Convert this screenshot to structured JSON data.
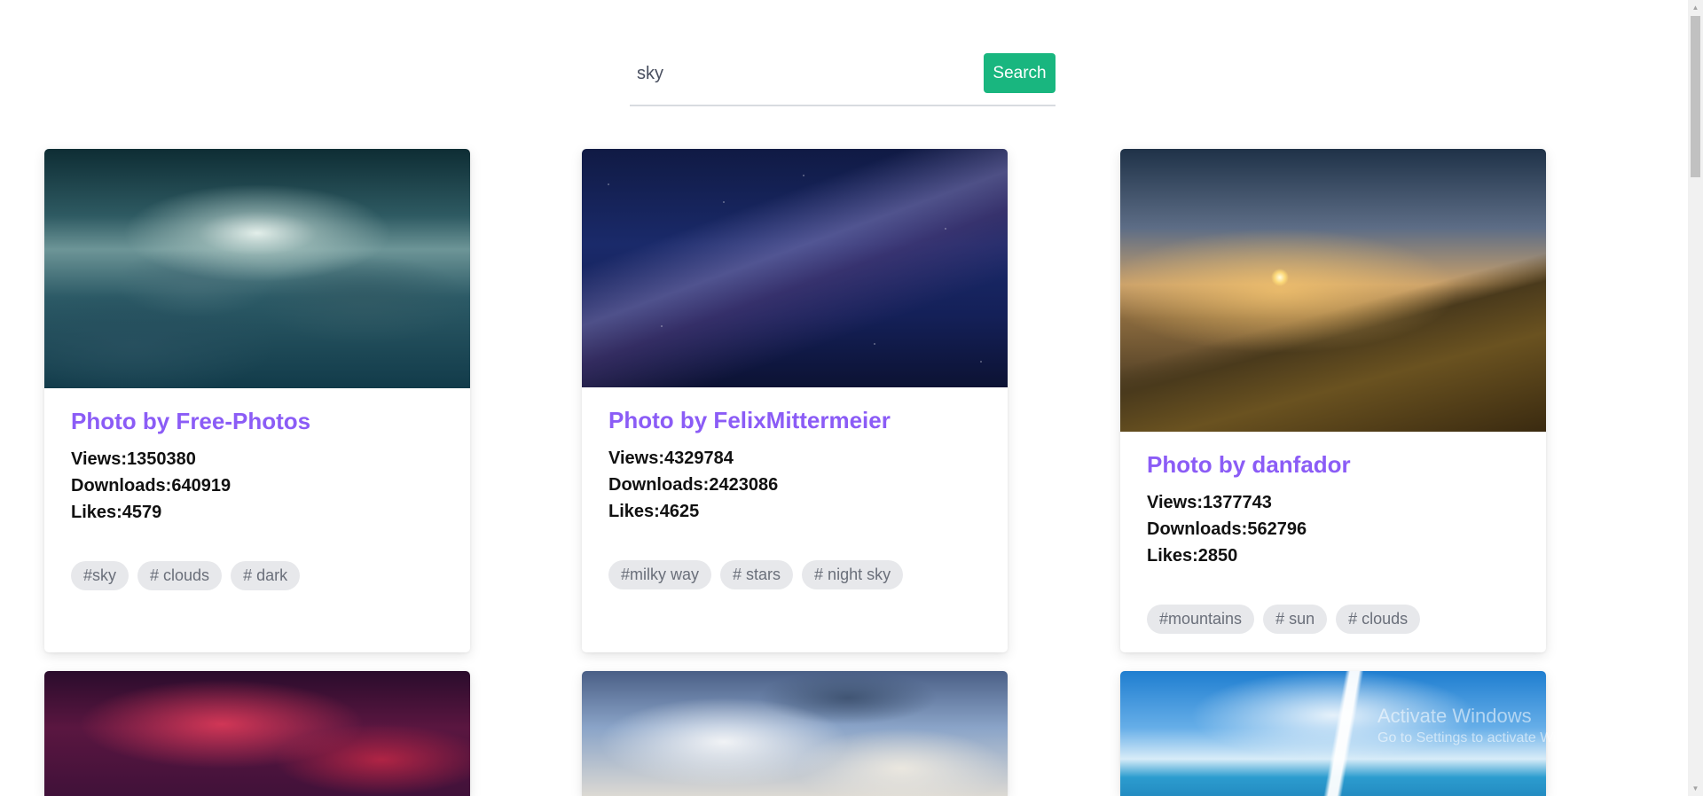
{
  "search": {
    "value": "sky",
    "button_label": "Search"
  },
  "colors": {
    "accent_button": "#19b67f",
    "title_purple": "#8b5cf6",
    "tag_background": "#e7e8eb"
  },
  "cards": [
    {
      "title": "Photo by Free-Photos",
      "views": "Views:1350380",
      "downloads": "Downloads:640919",
      "likes": "Likes:4579",
      "tags": [
        "#sky",
        "# clouds",
        "# dark"
      ]
    },
    {
      "title": "Photo by FelixMittermeier",
      "views": "Views:4329784",
      "downloads": "Downloads:2423086",
      "likes": "Likes:4625",
      "tags": [
        "#milky way",
        "# stars",
        "# night sky"
      ]
    },
    {
      "title": "Photo by danfador",
      "views": "Views:1377743",
      "downloads": "Downloads:562796",
      "likes": "Likes:2850",
      "tags": [
        "#mountains",
        "# sun",
        "# clouds"
      ]
    }
  ],
  "watermark": {
    "title": "Activate Windows",
    "subtitle": "Go to Settings to activate Windows."
  }
}
